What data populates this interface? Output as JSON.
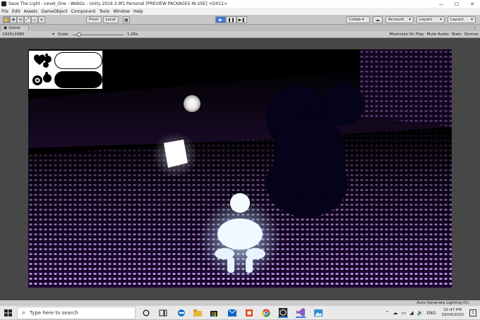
{
  "window": {
    "title": "Save The Light - Level_One - WebGL - Unity 2019.3.9f1 Personal [PREVIEW PACKAGES IN USE] <DX11>",
    "controls": {
      "minimize": "—",
      "maximize": "☐",
      "close": "✕"
    }
  },
  "menu": [
    "File",
    "Edit",
    "Assets",
    "GameObject",
    "Component",
    "Tools",
    "Window",
    "Help"
  ],
  "toolbar": {
    "tools": [
      "✋",
      "✥",
      "⟲",
      "⤢",
      "▭",
      "✕"
    ],
    "pivot_label": "Pivot",
    "local_label": "Local",
    "grid_glyph": "▦",
    "play_glyph": "▶",
    "pause_glyph": "❚❚",
    "step_glyph": "▶❚",
    "collab_label": "Collab ▾",
    "cloud_glyph": "☁",
    "account_label": "Account",
    "layers_label": "Layers",
    "layout_label": "Layout",
    "dropdown_arrow": "▾"
  },
  "game_view": {
    "tab_label": "Game",
    "tab_glyph": "▣",
    "resolution": "1920x1080",
    "scale_label": "Scale",
    "scale_value": "1.26x",
    "maximize_on_play": "Maximize On Play",
    "mute_audio": "Mute Audio",
    "stats": "Stats",
    "gizmos": "Gizmos",
    "menu_glyph": "⋮"
  },
  "status": {
    "text": "Auto Generate Lighting On"
  },
  "taskbar": {
    "search_placeholder": "Type here to search",
    "search_glyph": "⌕",
    "language": "ENG",
    "time": "02:47 PM",
    "date": "16/04/2020",
    "tray_glyphs": [
      "⌃",
      "☁",
      "▭",
      "◢",
      "🔊"
    ],
    "notification_glyph": "1"
  },
  "colors": {
    "accent_play": "#3c78d8",
    "floor_glow": "#b88cff",
    "viewport_bg": "#000000"
  }
}
